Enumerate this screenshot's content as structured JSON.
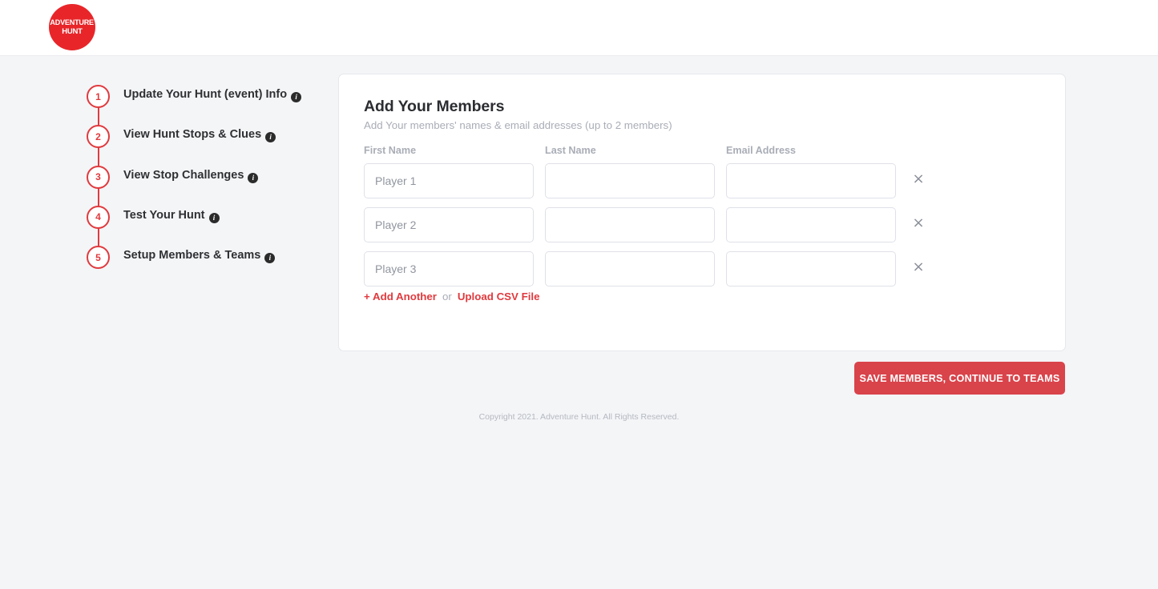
{
  "header": {
    "logo": {
      "icon": "adventure-hunt-logo",
      "line1": "ADVENTURE",
      "line2": "HUNT",
      "color": "#e8262a"
    }
  },
  "steps": {
    "accent_color": "#e03a3e",
    "info_icon": "i",
    "items": [
      {
        "number": "1",
        "label": "Update Your Hunt (event) Info"
      },
      {
        "number": "2",
        "label": "View Hunt Stops & Clues"
      },
      {
        "number": "3",
        "label": "View Stop Challenges"
      },
      {
        "number": "4",
        "label": "Test Your Hunt"
      },
      {
        "number": "5",
        "label": "Setup Members & Teams"
      }
    ]
  },
  "card": {
    "title": "Add Your Members",
    "subtitle": "Add Your members' names & email addresses (up to 2 members)",
    "columns": {
      "first_name": "First Name",
      "last_name": "Last Name",
      "email": "Email Address"
    },
    "rows": [
      {
        "first_placeholder": "Player 1",
        "first_value": "",
        "last_placeholder": "",
        "last_value": "",
        "email_placeholder": "",
        "email_value": "",
        "remove_icon": "×"
      },
      {
        "first_placeholder": "Player 2",
        "first_value": "",
        "last_placeholder": "",
        "last_value": "",
        "email_placeholder": "",
        "email_value": "",
        "remove_icon": "×"
      },
      {
        "first_placeholder": "Player 3",
        "first_value": "",
        "last_placeholder": "",
        "last_value": "",
        "email_placeholder": "",
        "email_value": "",
        "remove_icon": "×"
      }
    ],
    "links": {
      "add_another": "+ Add Another",
      "or": "or",
      "upload_csv": "Upload CSV File",
      "link_color": "#e03a3e"
    }
  },
  "actions": {
    "save_label": "SAVE MEMBERS, CONTINUE TO TEAMS",
    "save_color": "#d9434a"
  },
  "footer": {
    "copyright": "Copyright 2021. Adventure Hunt. All Rights Reserved."
  }
}
